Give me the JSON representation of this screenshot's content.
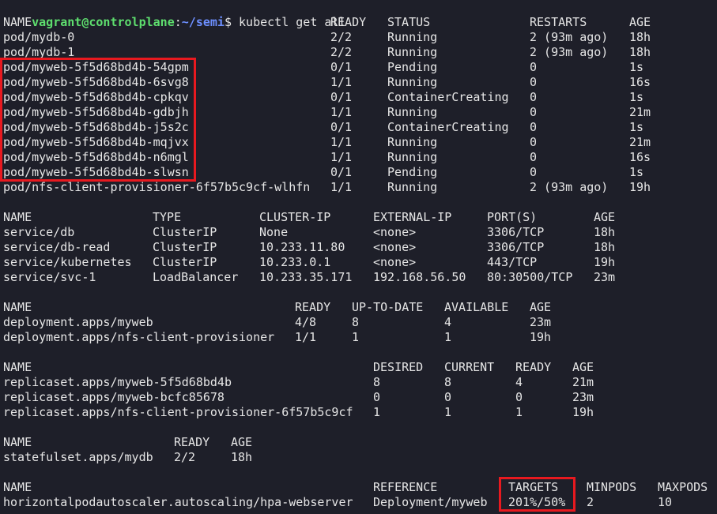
{
  "prompt": {
    "user_host": "vagrant@controlplane",
    "sep": ":",
    "path": "~/semi",
    "symbol": "$",
    "command": " kubectl get all"
  },
  "pods": {
    "headers": [
      "NAME",
      "READY",
      "STATUS",
      "RESTARTS",
      "AGE"
    ],
    "rows": [
      [
        "pod/mydb-0",
        "2/2",
        "Running",
        "2 (93m ago)",
        "18h"
      ],
      [
        "pod/mydb-1",
        "2/2",
        "Running",
        "2 (93m ago)",
        "18h"
      ],
      [
        "pod/myweb-5f5d68bd4b-54gpm",
        "0/1",
        "Pending",
        "0",
        "1s"
      ],
      [
        "pod/myweb-5f5d68bd4b-6svg8",
        "1/1",
        "Running",
        "0",
        "16s"
      ],
      [
        "pod/myweb-5f5d68bd4b-cpkqv",
        "0/1",
        "ContainerCreating",
        "0",
        "1s"
      ],
      [
        "pod/myweb-5f5d68bd4b-gdbjh",
        "1/1",
        "Running",
        "0",
        "21m"
      ],
      [
        "pod/myweb-5f5d68bd4b-j5s2c",
        "0/1",
        "ContainerCreating",
        "0",
        "1s"
      ],
      [
        "pod/myweb-5f5d68bd4b-mqjvx",
        "1/1",
        "Running",
        "0",
        "21m"
      ],
      [
        "pod/myweb-5f5d68bd4b-n6mgl",
        "1/1",
        "Running",
        "0",
        "16s"
      ],
      [
        "pod/myweb-5f5d68bd4b-slwsn",
        "0/1",
        "Pending",
        "0",
        "1s"
      ],
      [
        "pod/nfs-client-provisioner-6f57b5c9cf-wlhfn",
        "1/1",
        "Running",
        "2 (93m ago)",
        "19h"
      ]
    ]
  },
  "services": {
    "headers": [
      "NAME",
      "TYPE",
      "CLUSTER-IP",
      "EXTERNAL-IP",
      "PORT(S)",
      "AGE"
    ],
    "rows": [
      [
        "service/db",
        "ClusterIP",
        "None",
        "<none>",
        "3306/TCP",
        "18h"
      ],
      [
        "service/db-read",
        "ClusterIP",
        "10.233.11.80",
        "<none>",
        "3306/TCP",
        "18h"
      ],
      [
        "service/kubernetes",
        "ClusterIP",
        "10.233.0.1",
        "<none>",
        "443/TCP",
        "19h"
      ],
      [
        "service/svc-1",
        "LoadBalancer",
        "10.233.35.171",
        "192.168.56.50",
        "80:30500/TCP",
        "23m"
      ]
    ]
  },
  "deployments": {
    "headers": [
      "NAME",
      "READY",
      "UP-TO-DATE",
      "AVAILABLE",
      "AGE"
    ],
    "rows": [
      [
        "deployment.apps/myweb",
        "4/8",
        "8",
        "4",
        "23m"
      ],
      [
        "deployment.apps/nfs-client-provisioner",
        "1/1",
        "1",
        "1",
        "19h"
      ]
    ]
  },
  "replicasets": {
    "headers": [
      "NAME",
      "DESIRED",
      "CURRENT",
      "READY",
      "AGE"
    ],
    "rows": [
      [
        "replicaset.apps/myweb-5f5d68bd4b",
        "8",
        "8",
        "4",
        "21m"
      ],
      [
        "replicaset.apps/myweb-bcfc85678",
        "0",
        "0",
        "0",
        "23m"
      ],
      [
        "replicaset.apps/nfs-client-provisioner-6f57b5c9cf",
        "1",
        "1",
        "1",
        "19h"
      ]
    ]
  },
  "statefulsets": {
    "headers": [
      "NAME",
      "READY",
      "AGE"
    ],
    "rows": [
      [
        "statefulset.apps/mydb",
        "2/2",
        "18h"
      ]
    ]
  },
  "hpa": {
    "headers": [
      "NAME",
      "REFERENCE",
      "TARGETS",
      "MINPODS",
      "MAXPODS"
    ],
    "rows": [
      [
        "horizontalpodautoscaler.autoscaling/hpa-webserver",
        "Deployment/myweb",
        "201%/50%",
        "2",
        "10"
      ]
    ]
  },
  "colors": {
    "background": "#1e1f29",
    "text": "#e6e6e6",
    "prompt_user": "#5ede6e",
    "prompt_path": "#6d8fff",
    "highlight_box": "#e8191f"
  }
}
